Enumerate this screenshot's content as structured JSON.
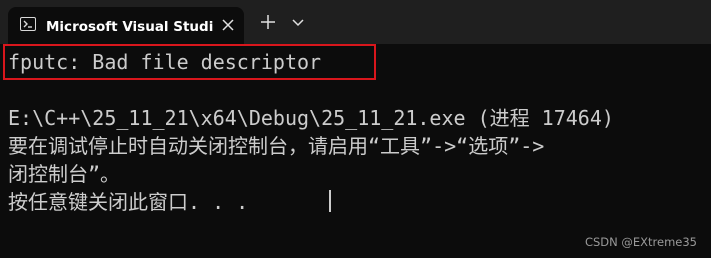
{
  "window": {
    "tab_title": "Microsoft Visual Studio 调试控",
    "icons": {
      "tab": "terminal-icon",
      "close": "close-icon",
      "new_tab": "plus-icon",
      "dropdown": "chevron-down-icon"
    }
  },
  "console": {
    "error_line": "fputc: Bad file descriptor",
    "lines": [
      "E:\\C++\\25_11_21\\x64\\Debug\\25_11_21.exe (进程 17464)",
      "要在调试停止时自动关闭控制台，请启用“工具”->“选项”->",
      "闭控制台”。",
      "按任意键关闭此窗口. . ."
    ],
    "highlight_color": "#d9161c"
  },
  "watermark": "CSDN @EXtreme35"
}
